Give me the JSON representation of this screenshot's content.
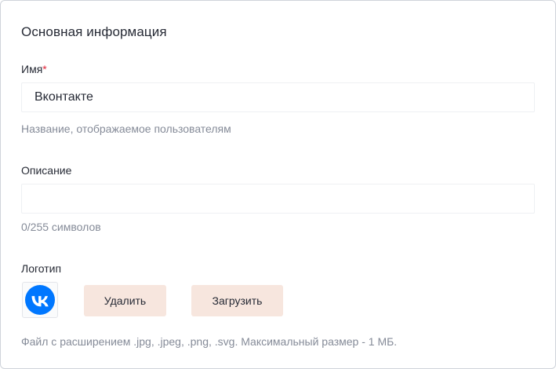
{
  "section": {
    "title": "Основная информация"
  },
  "name_field": {
    "label": "Имя",
    "required_mark": "*",
    "value": "Вконтакте",
    "placeholder": "",
    "hint": "Название, отображаемое пользователям"
  },
  "description_field": {
    "label": "Описание",
    "value": "",
    "placeholder": "",
    "counter": "0/255 символов"
  },
  "logo": {
    "label": "Логотип",
    "icon": "vk-logo-icon",
    "brand_color": "#0077ff",
    "delete_label": "Удалить",
    "upload_label": "Загрузить",
    "hint": "Файл с расширением .jpg, .jpeg, .png, .svg. Максимальный размер - 1 МБ."
  },
  "colors": {
    "button_bg": "#f7e6de",
    "required": "#e0283c",
    "hint_text": "#858b98"
  }
}
